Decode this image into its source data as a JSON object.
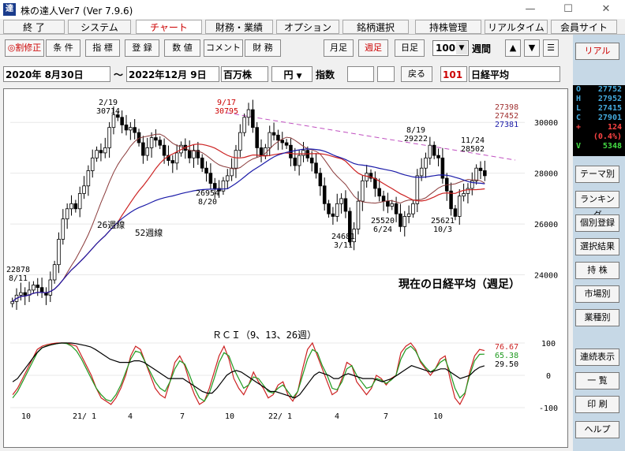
{
  "window": {
    "title": "株の達人Ver7 (Ver 7.9.6)",
    "icon": "達"
  },
  "menu": [
    "終 了",
    "システム",
    "チャート",
    "財務・業績",
    "オプション",
    "銘柄選択",
    "持株管理",
    "リアルタイム",
    "会員サイト"
  ],
  "toolbar": {
    "left": [
      "◎割修正",
      "条 件",
      "指 標",
      "登 録",
      "数 値",
      "コメント",
      "財 務"
    ],
    "week_day": [
      "月足",
      "週足",
      "日足"
    ],
    "count": "100",
    "period": "週間",
    "arrows": [
      "▲",
      "▼",
      "☰"
    ]
  },
  "datebar": {
    "from": "2020年 8月30日",
    "tilde": "〜",
    "to": "2022年12月 9日",
    "unit": "百万株",
    "currency": "円",
    "index_label": "指数",
    "back": "戻る",
    "code": "101",
    "name": "日経平均"
  },
  "right_panel": {
    "real": "リアル",
    "ohlc": [
      {
        "k": "O",
        "v": "27752"
      },
      {
        "k": "H",
        "v": "27952"
      },
      {
        "k": "L",
        "v": "27415"
      },
      {
        "k": "C",
        "v": "27901"
      },
      {
        "k": "+",
        "v": "124"
      },
      {
        "k": "",
        "v": "(0.4%)"
      },
      {
        "k": "V",
        "v": "5348"
      }
    ],
    "buttons": [
      "テーマ別",
      "ランキング",
      "個別登録",
      "選択結果",
      "持 株",
      "市場別",
      "業種別",
      "連続表示",
      "一 覧",
      "印 刷",
      "ヘルプ"
    ]
  },
  "colors": {
    "ma1": "#cc2222",
    "ma2": "#1a1aa8",
    "ma3": "#8a3a3a",
    "rci9": "#cc2222",
    "rci13": "#1f9a1f",
    "rci26": "#000000",
    "trend": "#c050c0"
  },
  "chart_data": [
    {
      "type": "candlestick",
      "ylim": [
        22000,
        31000
      ],
      "yticks": [
        24000,
        26000,
        28000,
        30000
      ],
      "ma_labels": [
        {
          "text": "26週線"
        },
        {
          "text": "52週線"
        }
      ],
      "ma_values": [
        "27398",
        "27452",
        "27381"
      ],
      "annotations": [
        {
          "lines": [
            "2/19",
            "30714"
          ]
        },
        {
          "lines": [
            "9/17",
            "30795"
          ],
          "red": true
        },
        {
          "lines": [
            "8/19",
            "29222"
          ]
        },
        {
          "lines": [
            "11/24",
            "28502"
          ]
        },
        {
          "lines": [
            "26954",
            "8/20"
          ]
        },
        {
          "lines": [
            "24681",
            "3/11"
          ]
        },
        {
          "lines": [
            "25520",
            "6/24"
          ]
        },
        {
          "lines": [
            "25621",
            "10/3"
          ]
        },
        {
          "lines": [
            "22878",
            "8/11"
          ]
        }
      ],
      "note": "現在の日経平均（週足）",
      "closes": [
        22950,
        23200,
        23300,
        23200,
        23400,
        23600,
        23500,
        23300,
        23200,
        23800,
        24400,
        25400,
        26200,
        26600,
        26800,
        26600,
        27200,
        27500,
        28100,
        28600,
        28900,
        28800,
        29000,
        29800,
        30300,
        30200,
        29900,
        29700,
        29800,
        29600,
        29200,
        28700,
        29000,
        29400,
        29300,
        29100,
        28700,
        28500,
        28400,
        28800,
        29100,
        28900,
        28600,
        28900,
        28600,
        28200,
        28000,
        27600,
        27400,
        27300,
        27700,
        27900,
        28200,
        28900,
        29600,
        30200,
        30500,
        29800,
        29000,
        28700,
        29000,
        29600,
        29500,
        29300,
        29200,
        29100,
        28600,
        28300,
        28700,
        28900,
        28600,
        28400,
        28000,
        27500,
        26800,
        26400,
        26300,
        26800,
        27000,
        26500,
        25300,
        25800,
        26900,
        27700,
        28000,
        27800,
        27400,
        27100,
        26900,
        26700,
        26800,
        26400,
        25900,
        26300,
        26400,
        26800,
        27900,
        28200,
        28600,
        29100,
        28700,
        28600,
        27800,
        27300,
        26600,
        26300,
        27100,
        27200,
        27400,
        27700,
        28200,
        28100,
        27900
      ]
    },
    {
      "type": "line",
      "title": "ＲＣＩ（9、13、26週）",
      "ylim": [
        -100,
        100
      ],
      "yticks": [
        100,
        0,
        -100
      ],
      "latest": [
        "76.67",
        "65.38",
        "29.50"
      ],
      "series": [
        {
          "values": [
            -60,
            -40,
            -10,
            20,
            50,
            80,
            90,
            95,
            98,
            100,
            100,
            100,
            95,
            90,
            60,
            30,
            0,
            -40,
            -70,
            -80,
            -90,
            -70,
            -40,
            0,
            60,
            90,
            80,
            40,
            0,
            -40,
            -60,
            -70,
            -20,
            40,
            60,
            30,
            -20,
            -60,
            -90,
            -80,
            -40,
            10,
            60,
            90,
            50,
            -10,
            -40,
            -60,
            -30,
            10,
            -20,
            -40,
            -70,
            -60,
            -30,
            -20,
            -60,
            -80,
            -50,
            20,
            80,
            100,
            60,
            20,
            -20,
            -60,
            -50,
            -10,
            40,
            30,
            -20,
            -40,
            -60,
            -40,
            0,
            -10,
            -30,
            -10,
            0,
            70,
            90,
            100,
            80,
            40,
            20,
            0,
            20,
            50,
            60,
            -10,
            -70,
            -90,
            -60,
            10,
            60,
            80,
            76.67
          ]
        },
        {
          "values": [
            -70,
            -50,
            -20,
            10,
            40,
            70,
            85,
            92,
            95,
            98,
            100,
            98,
            90,
            75,
            50,
            20,
            -10,
            -40,
            -60,
            -75,
            -80,
            -60,
            -30,
            10,
            50,
            75,
            70,
            40,
            10,
            -20,
            -40,
            -50,
            -20,
            20,
            45,
            35,
            0,
            -40,
            -70,
            -80,
            -55,
            -10,
            40,
            70,
            60,
            20,
            -10,
            -40,
            -30,
            -5,
            -10,
            -30,
            -50,
            -55,
            -40,
            -30,
            -50,
            -70,
            -50,
            0,
            50,
            80,
            70,
            30,
            0,
            -40,
            -45,
            -20,
            20,
            30,
            0,
            -20,
            -40,
            -35,
            -10,
            -15,
            -25,
            -15,
            0,
            50,
            80,
            90,
            75,
            45,
            25,
            10,
            20,
            40,
            50,
            10,
            -40,
            -70,
            -55,
            0,
            45,
            65,
            65.38
          ]
        },
        {
          "values": [
            -20,
            -10,
            10,
            30,
            50,
            70,
            85,
            90,
            95,
            98,
            100,
            100,
            100,
            98,
            95,
            92,
            88,
            80,
            70,
            60,
            50,
            45,
            40,
            40,
            40,
            45,
            45,
            40,
            30,
            20,
            10,
            0,
            -10,
            -10,
            -10,
            -10,
            -20,
            -30,
            -40,
            -50,
            -55,
            -55,
            -40,
            -20,
            0,
            10,
            15,
            10,
            0,
            -10,
            -20,
            -30,
            -40,
            -50,
            -50,
            -55,
            -60,
            -65,
            -70,
            -60,
            -40,
            -20,
            0,
            10,
            5,
            0,
            -10,
            -10,
            0,
            5,
            0,
            -5,
            -10,
            -10,
            -10,
            -15,
            -20,
            -15,
            -10,
            0,
            10,
            20,
            30,
            25,
            20,
            15,
            10,
            15,
            20,
            20,
            10,
            0,
            -10,
            -5,
            0,
            15,
            25,
            29.5
          ]
        }
      ],
      "x_ticks": [
        "10",
        "21/ 1",
        "4",
        "7",
        "10",
        "22/ 1",
        "4",
        "7",
        "10"
      ]
    }
  ]
}
